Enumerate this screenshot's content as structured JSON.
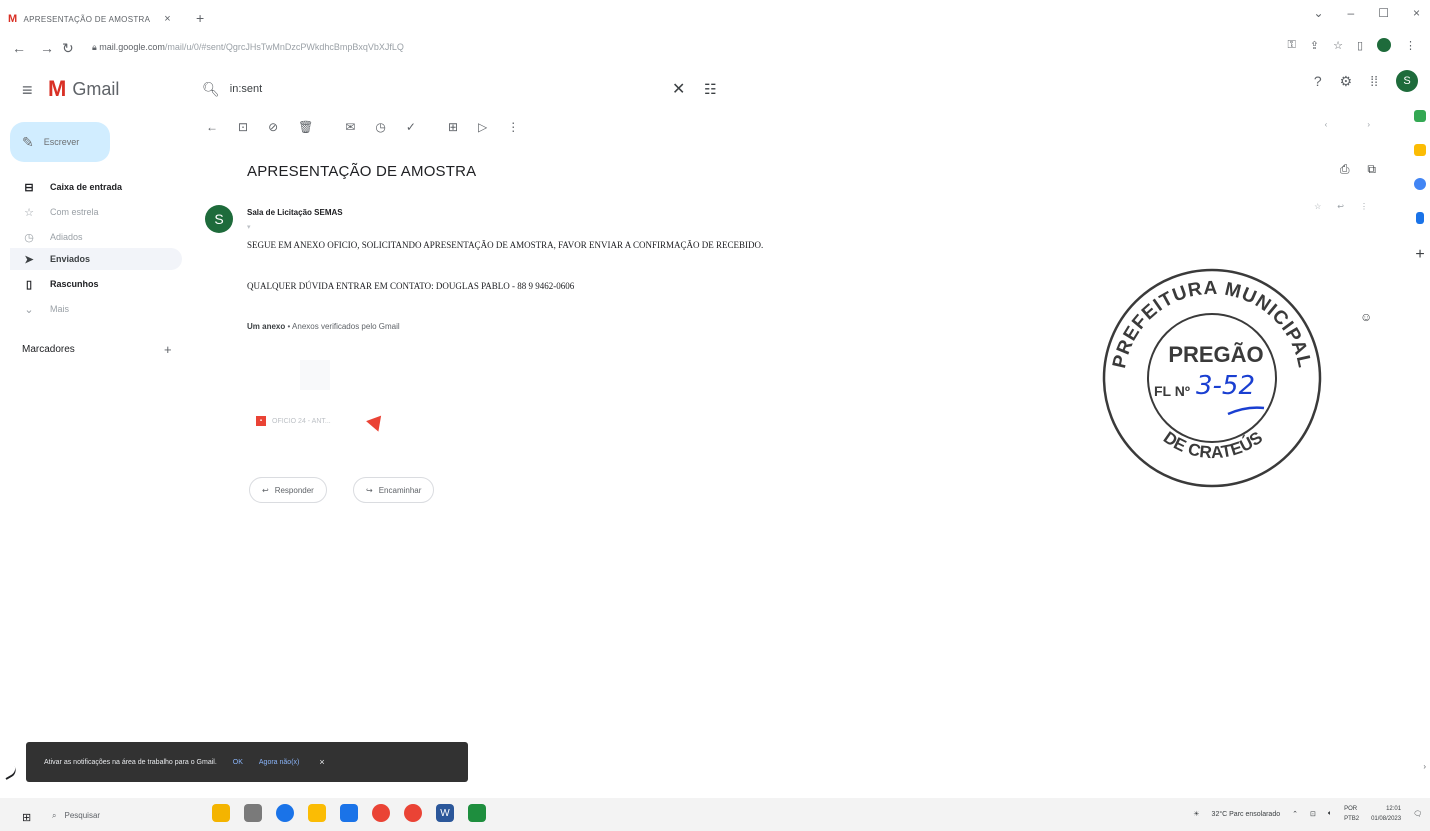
{
  "browser": {
    "tab_title": "APRESENTAÇÃO DE AMOSTRA",
    "tab_close": "×",
    "new_tab": "+",
    "url_host": "mail.google.com",
    "url_path": "/mail/u/0/#sent/QgrcJHsTwMnDzcPWkdhcBmpBxqVbXJfLQ",
    "window_controls": [
      "⌄",
      "–",
      "☐",
      "×"
    ]
  },
  "gmail": {
    "app_name": "Gmail",
    "search": {
      "value": "in:sent"
    }
  },
  "sidebar": {
    "compose_label": "Escrever",
    "items": [
      {
        "label": "Caixa de entrada",
        "icon": "inbox-icon",
        "style": "bold"
      },
      {
        "label": "Com estrela",
        "icon": "star-icon",
        "style": "light"
      },
      {
        "label": "Adiados",
        "icon": "clock-icon",
        "style": "light"
      },
      {
        "label": "Enviados",
        "icon": "send-icon",
        "style": "active"
      },
      {
        "label": "Rascunhos",
        "icon": "draft-icon",
        "style": "bold"
      },
      {
        "label": "Mais",
        "icon": "chevron-down-icon",
        "style": "light"
      }
    ],
    "labels_title": "Marcadores"
  },
  "email": {
    "subject": "APRESENTAÇÃO DE AMOSTRA",
    "sender_initial": "S",
    "sender_name": "Sala de Licitação SEMAS",
    "body": [
      "SEGUE EM ANEXO OFICIO, SOLICITANDO APRESENTAÇÃO DE AMOSTRA, FAVOR ENVIAR A CONFIRMAÇÃO DE RECEBIDO.",
      "QUALQUER DÚVIDA ENTRAR EM CONTATO: DOUGLAS PABLO - 88 9 9462-0606"
    ],
    "attachments_title": "Um anexo",
    "attachments_note": "• Anexos verificados pelo Gmail",
    "attachment_name": "OFICIO 24 - ANT...",
    "reply_label": "Responder",
    "forward_label": "Encaminhar"
  },
  "stamp": {
    "top_text": "PREFEITURA MUNICIPAL",
    "center_text": "PREGÃO",
    "fl_label": "FL Nº",
    "handwritten": "3-52",
    "bottom_text": "DE CRATEÚS"
  },
  "snackbar": {
    "message": "Ativar as notificações na área de trabalho para o Gmail.",
    "ok": "OK",
    "later": "Agora não(x)",
    "close": "×"
  },
  "taskbar": {
    "search_label": "Pesquisar",
    "weather": "32°C Parc ensolarado",
    "lang_top": "POR",
    "lang_bottom": "PTB2",
    "time": "12:01",
    "date": "01/08/2023"
  },
  "colors": {
    "accent": "#1e6b3b",
    "stamp_ink": "#3a3a3a",
    "pen_ink": "#1a3fd1"
  }
}
